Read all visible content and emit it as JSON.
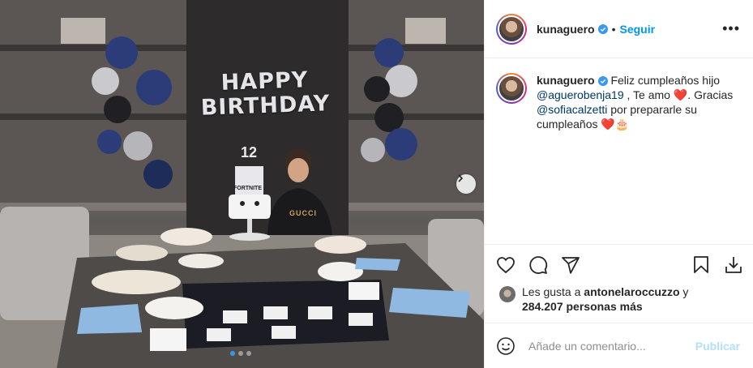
{
  "post": {
    "username": "kunaguero",
    "follow_label": "Seguir",
    "separator": "•",
    "more_label": "•••",
    "photo": {
      "description_icon": "photo",
      "banner_text": "HAPPY BIRTHDAY",
      "cake_number": "12",
      "cake_label": "FORTNITE",
      "shirt_text": "GUCCI",
      "carousel_pages": 3,
      "carousel_active": 1
    },
    "caption": {
      "username": "kunaguero",
      "text_1": " Feliz cumpleaños hijo ",
      "mention_1": "@aguerobenja19",
      "text_2": " , Te amo ❤️.",
      "text_3": " Gracias ",
      "mention_2": "@sofiacalzetti",
      "text_4": " por prepararle su cumpleaños ❤️🎂"
    },
    "icons": {
      "like": "heart-icon",
      "comment": "comment-icon",
      "share": "share-icon",
      "save": "bookmark-icon",
      "download": "download-icon",
      "emoji": "smiley-icon"
    },
    "likes": {
      "prefix": "Les gusta a ",
      "user": "antonelaroccuzzo",
      "connector": " y",
      "count": "284.207 personas más"
    },
    "comment_box": {
      "placeholder": "Añade un comentario...",
      "publish_label": "Publicar"
    },
    "colors": {
      "link": "#0095f6",
      "mention": "#00376b",
      "publish_disabled": "#b2dffc",
      "verified": "#3897f0"
    }
  }
}
